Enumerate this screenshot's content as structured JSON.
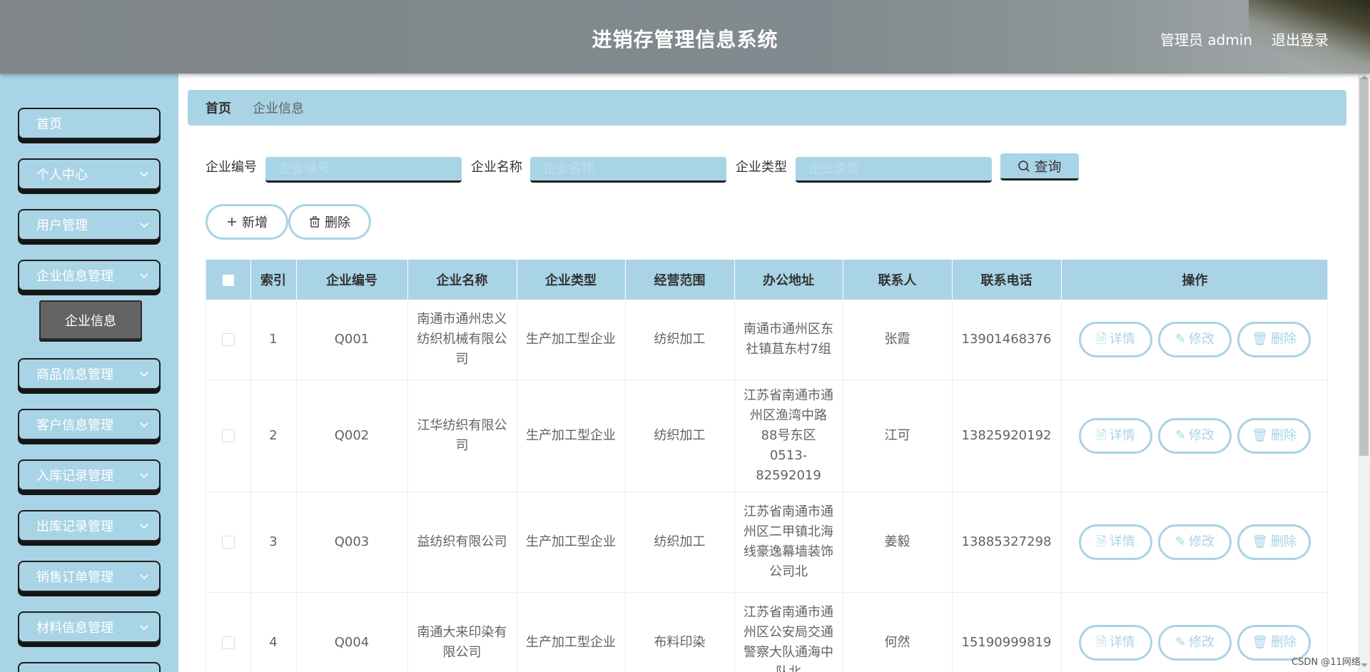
{
  "header": {
    "title": "进销存管理信息系统",
    "user": "管理员 admin",
    "logout": "退出登录"
  },
  "sidebar": {
    "items": [
      {
        "label": "首页"
      },
      {
        "label": "个人中心"
      },
      {
        "label": "用户管理"
      },
      {
        "label": "企业信息管理"
      },
      {
        "label": "商品信息管理"
      },
      {
        "label": "客户信息管理"
      },
      {
        "label": "入库记录管理"
      },
      {
        "label": "出库记录管理"
      },
      {
        "label": "销售订单管理"
      },
      {
        "label": "材料信息管理"
      }
    ],
    "sub_item": "企业信息"
  },
  "breadcrumb": {
    "home": "首页",
    "separator": "/",
    "current": "企业信息"
  },
  "search": {
    "fields": [
      {
        "label": "企业编号",
        "placeholder": "企业编号",
        "value": ""
      },
      {
        "label": "企业名称",
        "placeholder": "企业名称",
        "value": ""
      },
      {
        "label": "企业类型",
        "placeholder": "企业类型",
        "value": ""
      }
    ],
    "query_label": "查询"
  },
  "actions": {
    "add_label": "新增",
    "delete_label": "删除"
  },
  "table": {
    "columns": [
      "索引",
      "企业编号",
      "企业名称",
      "企业类型",
      "经营范围",
      "办公地址",
      "联系人",
      "联系电话",
      "操作"
    ],
    "rows": [
      {
        "index": "1",
        "code": "Q001",
        "name": "南通市通州忠义纺织机械有限公司",
        "type": "生产加工型企业",
        "scope": "纺织加工",
        "address": "南通市通州区东社镇苴东村7组",
        "contact": "张霞",
        "phone": "13901468376"
      },
      {
        "index": "2",
        "code": "Q002",
        "name": "江华纺织有限公司",
        "type": "生产加工型企业",
        "scope": "纺织加工",
        "address": "江苏省南通市通州区渔湾中路88号东区0513-82592019",
        "contact": "江可",
        "phone": "13825920192"
      },
      {
        "index": "3",
        "code": "Q003",
        "name": "益纺织有限公司",
        "type": "生产加工型企业",
        "scope": "纺织加工",
        "address": "江苏省南通市通州区二甲镇北海线豪逸幕墙装饰公司北",
        "contact": "姜毅",
        "phone": "13885327298"
      },
      {
        "index": "4",
        "code": "Q004",
        "name": "南通大来印染有限公司",
        "type": "生产加工型企业",
        "scope": "布料印染",
        "address": "江苏省南通市通州区公安局交通警察大队通海中队北",
        "contact": "何然",
        "phone": "15190999819"
      }
    ],
    "op_labels": {
      "detail": "详情",
      "edit": "修改",
      "delete": "删除"
    }
  },
  "watermark": "CSDN @11网络"
}
